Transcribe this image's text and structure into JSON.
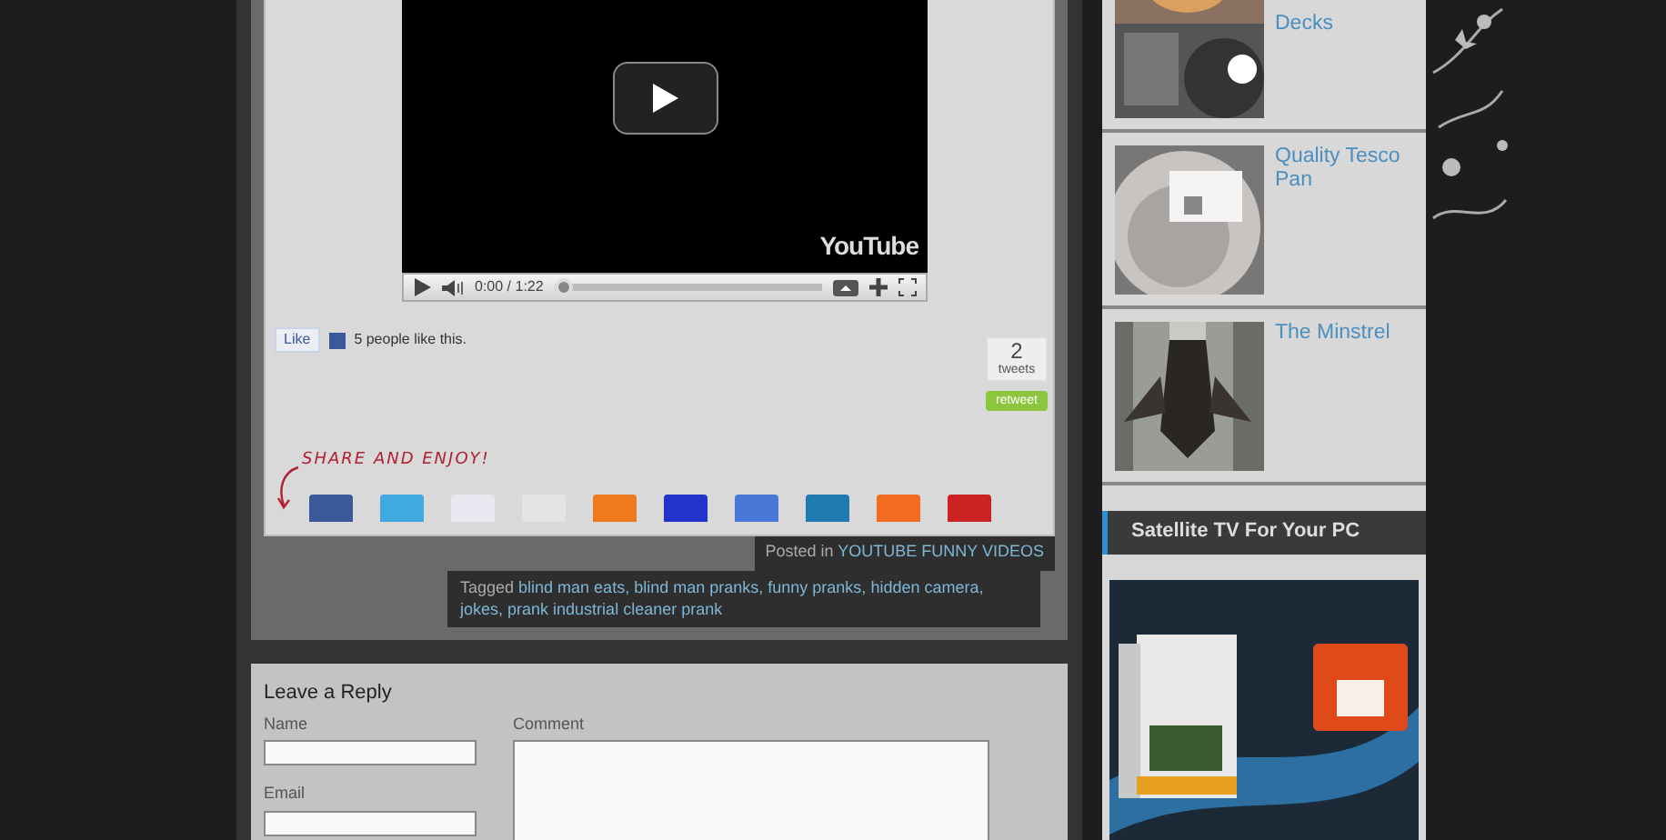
{
  "video": {
    "logo": "YouTube",
    "time": "0:00 / 1:22",
    "level": 0
  },
  "like": {
    "button": "Like",
    "text": "5 people like this."
  },
  "tweets": {
    "count": "2",
    "label": "tweets",
    "button": "retweet"
  },
  "share": {
    "title": "SHARE AND ENJOY!",
    "buttons": [
      {
        "color": "#3b5998"
      },
      {
        "color": "#3fa9e0"
      },
      {
        "color": "#e8e8f0"
      },
      {
        "color": "#e4e4e4"
      },
      {
        "color": "#f07a20"
      },
      {
        "color": "#2233cc"
      },
      {
        "color": "#4a78d8"
      },
      {
        "color": "#1f7ab0"
      },
      {
        "color": "#f26b21"
      },
      {
        "color": "#cc2222"
      }
    ]
  },
  "meta": {
    "posted_label": "Posted in",
    "category": "YOUTUBE FUNNY VIDEOS",
    "tagged_label": "Tagged",
    "tags": [
      "blind man eats,",
      "blind man pranks,",
      "funny pranks,",
      "hidden camera,",
      "jokes,",
      "prank industrial cleaner prank"
    ]
  },
  "reply": {
    "title": "Leave a Reply",
    "fields": [
      {
        "label": "Name"
      },
      {
        "label": "Email"
      }
    ],
    "comment_label": "Comment"
  },
  "sidebar": {
    "posts": [
      {
        "title": "Decks",
        "kind": "picture"
      },
      {
        "title": "Quality Tesco Pan",
        "kind": "picture"
      },
      {
        "title": "The Minstrel",
        "kind": "picture"
      }
    ],
    "widget_title": "Satellite TV For Your PC"
  }
}
